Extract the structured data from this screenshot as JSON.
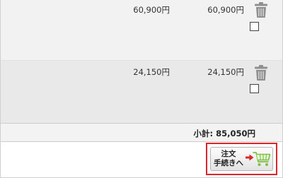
{
  "cart": {
    "items": [
      {
        "unit_price": "60,900円",
        "total": "60,900円"
      },
      {
        "unit_price": "24,150円",
        "total": "24,150円"
      }
    ],
    "subtotal": "小計: 85,050円"
  },
  "checkout": {
    "line1": "注文",
    "line2": "手続きへ"
  },
  "icons": {
    "trash": "trash-icon",
    "arrow": "arrow-right-icon",
    "cart": "shopping-cart-icon"
  },
  "colors": {
    "highlight_border": "#d9262b",
    "cart_green": "#7cc143",
    "arrow_red": "#d9262b"
  }
}
